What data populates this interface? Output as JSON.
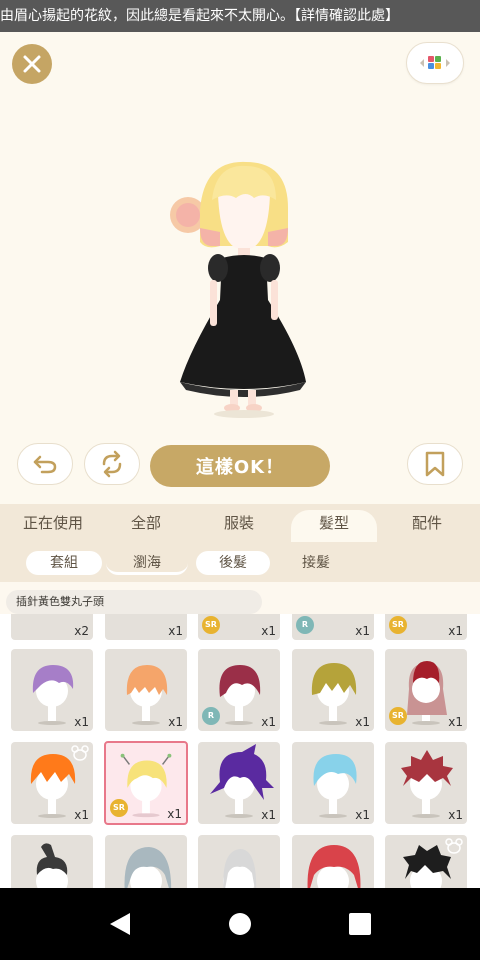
{
  "ticker": {
    "text": "由眉心揚起的花紋，因此總是看起來不太開心。【詳情確認此處】"
  },
  "buttons": {
    "ok_label": "這樣OK！"
  },
  "tabs": [
    {
      "label": "正在使用"
    },
    {
      "label": "全部"
    },
    {
      "label": "服裝"
    },
    {
      "label": "髮型",
      "active": true
    },
    {
      "label": "配件"
    }
  ],
  "subtabs": [
    {
      "label": "套組"
    },
    {
      "label": "瀏海",
      "active": true
    },
    {
      "label": "後髮"
    },
    {
      "label": "接髮"
    }
  ],
  "selected_item_name": "插針黃色雙丸子頭",
  "items": {
    "row0": [
      {
        "qty": "x2"
      },
      {
        "qty": "x1"
      },
      {
        "qty": "x1",
        "rarity": "SR"
      },
      {
        "qty": "x1",
        "rarity": "R"
      },
      {
        "qty": "x1",
        "rarity": "SR"
      }
    ],
    "row1": [
      {
        "qty": "x1",
        "hair": "#a67ec8"
      },
      {
        "qty": "x1",
        "hair": "#f5a56a"
      },
      {
        "qty": "x1",
        "hair": "#9a2f48",
        "rarity": "R"
      },
      {
        "qty": "x1",
        "hair": "#b5a33a"
      },
      {
        "qty": "x1",
        "hair": "#a51e2a",
        "rarity": "SR"
      }
    ],
    "row2": [
      {
        "qty": "x1",
        "hair": "#ff7a1a"
      },
      {
        "qty": "x1",
        "hair": "#f7e27a",
        "rarity": "SR",
        "selected": true
      },
      {
        "qty": "x1",
        "hair": "#5a2aa0"
      },
      {
        "qty": "x1",
        "hair": "#88d2ea"
      },
      {
        "qty": "x1",
        "hair": "#a8353f"
      }
    ],
    "row3": [
      {
        "hair": "#3a3a3a"
      },
      {
        "hair": "#a9b8bf"
      },
      {
        "hair": "#d8d8d8"
      },
      {
        "hair": "#d9434a"
      },
      {
        "hair": "#1e1e1e"
      }
    ],
    "rarity_labels": {
      "sr": "SR",
      "r": "R"
    }
  },
  "colors": {
    "accent": "#c7a866",
    "tab_bg": "#f2e8d8",
    "selected_border": "#e8788a"
  }
}
